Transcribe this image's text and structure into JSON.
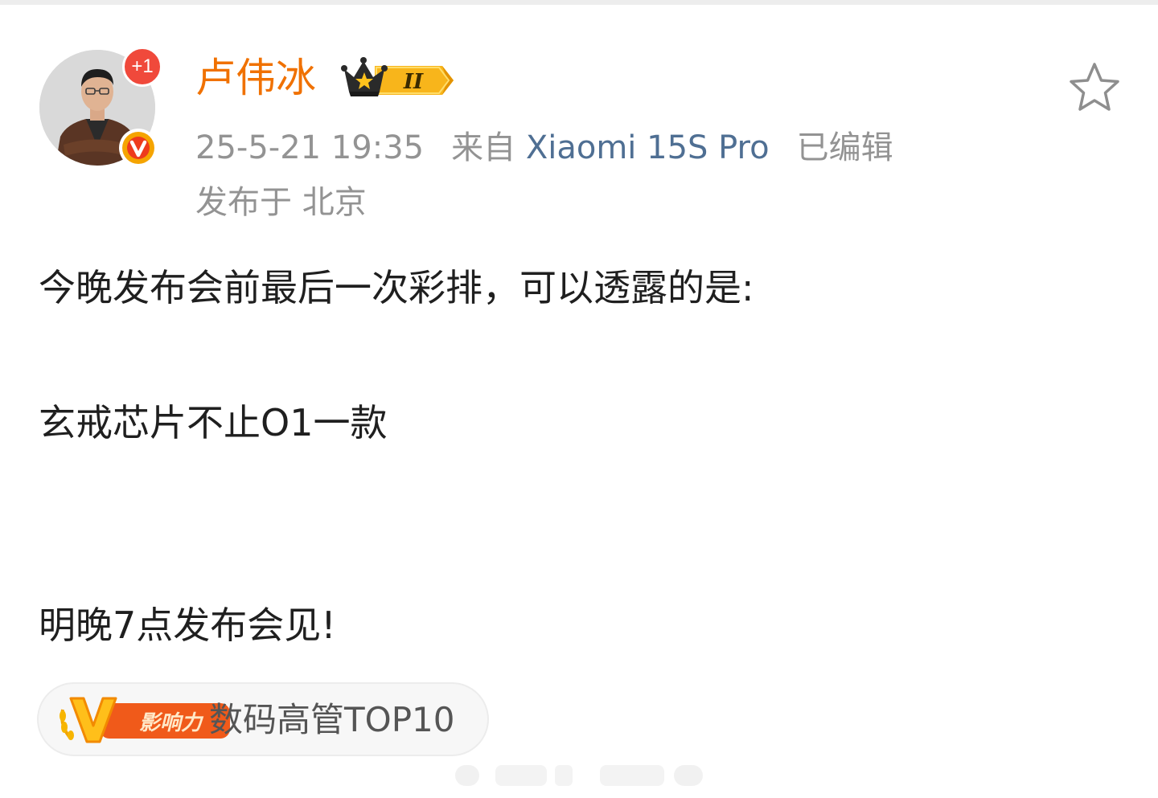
{
  "post": {
    "author": {
      "name": "卢伟冰",
      "follow_badge": "+1",
      "avatar_icon": "avatar-photo-icon",
      "verified_icon": "verified-v-icon",
      "member_badge_icon": "crown-level-badge-icon",
      "member_level": "II"
    },
    "meta": {
      "time": "25-5-21 19:35",
      "source_prefix": "来自",
      "device": "Xiaomi 15S Pro",
      "edited": "已编辑",
      "location": "发布于 北京"
    },
    "content": {
      "line1": "今晚发布会前最后一次彩排，可以透露的是:",
      "line2": "玄戒芯片不止O1一款",
      "line3": "明晚7点发布会见!"
    },
    "influence": {
      "logo_text": "影响力",
      "label": "数码高管TOP10"
    }
  },
  "colors": {
    "username": "#f07100",
    "device": "#4f6f93",
    "meta": "#939393",
    "text": "#1f1f1f",
    "badge_red": "#f0493b",
    "gold": "#f5a400"
  }
}
